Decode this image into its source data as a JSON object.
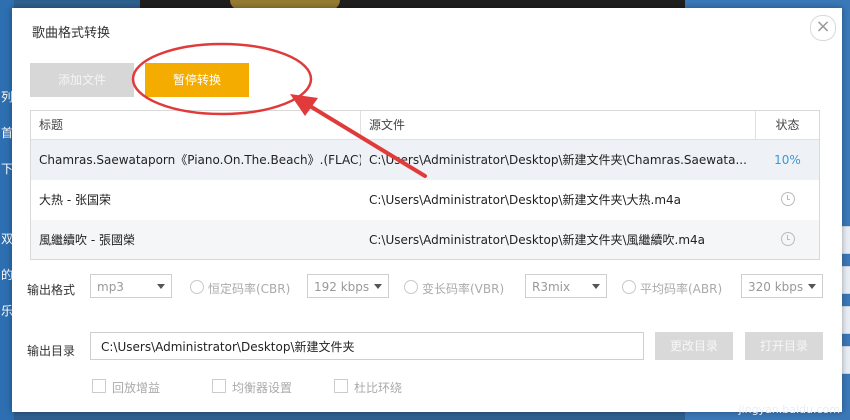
{
  "dialog": {
    "title": "歌曲格式转换",
    "close_glyph": "×"
  },
  "toolbar": {
    "add_label": "添加文件",
    "pause_label": "暂停转换"
  },
  "table": {
    "headers": [
      "标题",
      "源文件",
      "状态"
    ],
    "rows": [
      {
        "title": "Chamras.Saewataporn《Piano.On.The.Beach》.(FLAC)",
        "source": "C:\\Users\\Administrator\\Desktop\\新建文件夹\\Chamras.Saewata...",
        "status": "10%"
      },
      {
        "title": "大热 - 张国荣",
        "source": "C:\\Users\\Administrator\\Desktop\\新建文件夹\\大热.m4a",
        "status": "clock-icon"
      },
      {
        "title": "風繼續吹 - 張國榮",
        "source": "C:\\Users\\Administrator\\Desktop\\新建文件夹\\風繼續吹.m4a",
        "status": "clock-icon"
      }
    ]
  },
  "output": {
    "format_label": "输出格式",
    "format_value": "mp3",
    "cbr_label": "恒定码率(CBR)",
    "cbr_value": "192 kbps",
    "vbr_label": "变长码率(VBR)",
    "vbr_value": "R3mix",
    "abr_label": "平均码率(ABR)",
    "abr_value": "320 kbps",
    "dir_label": "输出目录",
    "dir_value": "C:\\Users\\Administrator\\Desktop\\新建文件夹",
    "change_dir_label": "更改目录",
    "open_dir_label": "打开目录",
    "replay_gain_label": "回放增益",
    "equalizer_label": "均衡器设置",
    "dolby_label": "杜比环绕"
  },
  "background": {
    "left_chars": [
      "列",
      "首",
      "下",
      "双",
      "的",
      "乐"
    ],
    "watermark": "jingyan.baidu.com"
  },
  "colors": {
    "accent": "#f5ac00",
    "annotation": "#e03a3a",
    "progress": "#3a97d8"
  }
}
